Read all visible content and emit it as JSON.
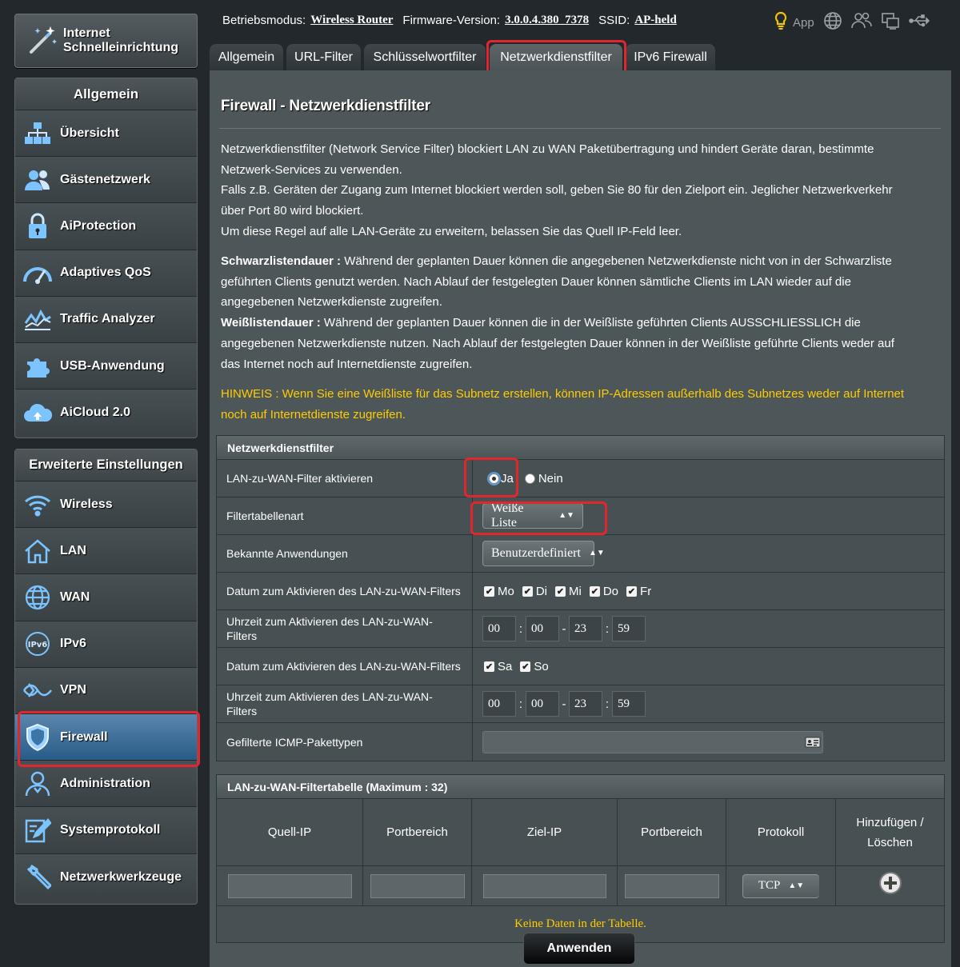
{
  "qis": {
    "label_line1": "Internet",
    "label_line2": "Schnelleinrichtung"
  },
  "general": {
    "title": "Allgemein",
    "items": [
      {
        "label": "Übersicht",
        "icon": "network-map-icon"
      },
      {
        "label": "Gästenetzwerk",
        "icon": "guest-network-icon"
      },
      {
        "label": "AiProtection",
        "icon": "lock-icon"
      },
      {
        "label": "Adaptives QoS",
        "icon": "speedometer-icon"
      },
      {
        "label": "Traffic Analyzer",
        "icon": "traffic-chart-icon"
      },
      {
        "label": "USB-Anwendung",
        "icon": "puzzle-icon"
      },
      {
        "label": "AiCloud 2.0",
        "icon": "cloud-icon"
      }
    ]
  },
  "advanced": {
    "title": "Erweiterte Einstellungen",
    "items": [
      {
        "label": "Wireless",
        "icon": "wifi-icon"
      },
      {
        "label": "LAN",
        "icon": "home-icon"
      },
      {
        "label": "WAN",
        "icon": "globe-icon"
      },
      {
        "label": "IPv6",
        "icon": "ipv6-icon"
      },
      {
        "label": "VPN",
        "icon": "vpn-icon"
      },
      {
        "label": "Firewall",
        "icon": "shield-icon"
      },
      {
        "label": "Administration",
        "icon": "user-admin-icon"
      },
      {
        "label": "Systemprotokoll",
        "icon": "log-edit-icon"
      },
      {
        "label": "Netzwerkwerkzeuge",
        "icon": "tools-icon"
      }
    ]
  },
  "topbar": {
    "mode_label": "Betriebsmodus:",
    "mode_value": "Wireless Router",
    "fw_label": "Firmware-Version:",
    "fw_value": "3.0.0.4.380_7378",
    "ssid_label": "SSID:",
    "ssid_value": "AP-held",
    "app_label": "App"
  },
  "tabs": [
    "Allgemein",
    "URL-Filter",
    "Schlüsselwortfilter",
    "Netzwerkdienstfilter",
    "IPv6 Firewall"
  ],
  "page": {
    "title": "Firewall - Netzwerkdienstfilter",
    "desc_lines": [
      "Netzwerkdienstfilter (Network Service Filter) blockiert LAN zu WAN Paketübertragung und hindert Geräte daran, bestimmte",
      "Netzwerk-Services zu verwenden.",
      "Falls z.B. Geräten der Zugang zum Internet blockiert werden soll, geben Sie 80 für den Zielport ein. Jeglicher Netzwerkverkehr",
      "über Port 80 wird blockiert.",
      "Um diese Regel auf alle LAN-Geräte zu erweitern, belassen Sie das Quell IP-Feld leer."
    ],
    "blacklist_label": "Schwarzlistendauer :",
    "blacklist_lines": [
      " Während der geplanten Dauer können die angegebenen Netzwerkdienste nicht von in der Schwarzliste",
      "geführten Clients genutzt werden. Nach Ablauf der festgelegten Dauer können sämtliche Clients im LAN wieder auf die",
      "angegebenen Netzwerkdienste zugreifen."
    ],
    "whitelist_label": "Weißlistendauer :",
    "whitelist_lines": [
      " Während der geplanten Dauer können die in der Weißliste geführten Clients AUSSCHLIESSLICH die",
      "angegebenen Netzwerkdienste nutzen. Nach Ablauf der festgelegten Dauer können in der Weißliste geführte Clients weder auf",
      "das Internet noch auf Internetdienste zugreifen."
    ],
    "hint_lines": [
      "HINWEIS : Wenn Sie eine Weißliste für das Subnetz erstellen, können IP-Adressen außerhalb des Subnetzes weder auf Internet",
      "noch auf Internetdienste zugreifen."
    ]
  },
  "filter": {
    "header": "Netzwerkdienstfilter",
    "enable_label": "LAN-zu-WAN-Filter aktivieren",
    "yes": "Ja",
    "no": "Nein",
    "type_label": "Filtertabellenart",
    "type_value": "Weiße Liste",
    "apps_label": "Bekannte Anwendungen",
    "apps_value": "Benutzerdefiniert",
    "date1_label": "Datum zum Aktivieren des LAN-zu-WAN-Filters",
    "weekdays": [
      "Mo",
      "Di",
      "Mi",
      "Do",
      "Fr"
    ],
    "time1_label": "Uhrzeit zum Aktivieren des LAN-zu-WAN-Filters",
    "time1": [
      "00",
      "00",
      "23",
      "59"
    ],
    "date2_label": "Datum zum Aktivieren des LAN-zu-WAN-Filters",
    "weekend": [
      "Sa",
      "So"
    ],
    "time2_label": "Uhrzeit zum Aktivieren des LAN-zu-WAN-Filters",
    "time2": [
      "00",
      "00",
      "23",
      "59"
    ],
    "icmp_label": "Gefilterte ICMP-Pakettypen"
  },
  "table": {
    "header": "LAN-zu-WAN-Filtertabelle (Maximum : 32)",
    "columns": [
      "Quell-IP",
      "Portbereich",
      "Ziel-IP",
      "Portbereich",
      "Protokoll",
      "Hinzufügen / Löschen"
    ],
    "protocol_value": "TCP",
    "empty": "Keine Daten in der Tabelle."
  },
  "apply_label": "Anwenden",
  "colors": {
    "highlight": "#e3262e",
    "hint": "#ffcc00",
    "active_nav": "#275c88"
  }
}
